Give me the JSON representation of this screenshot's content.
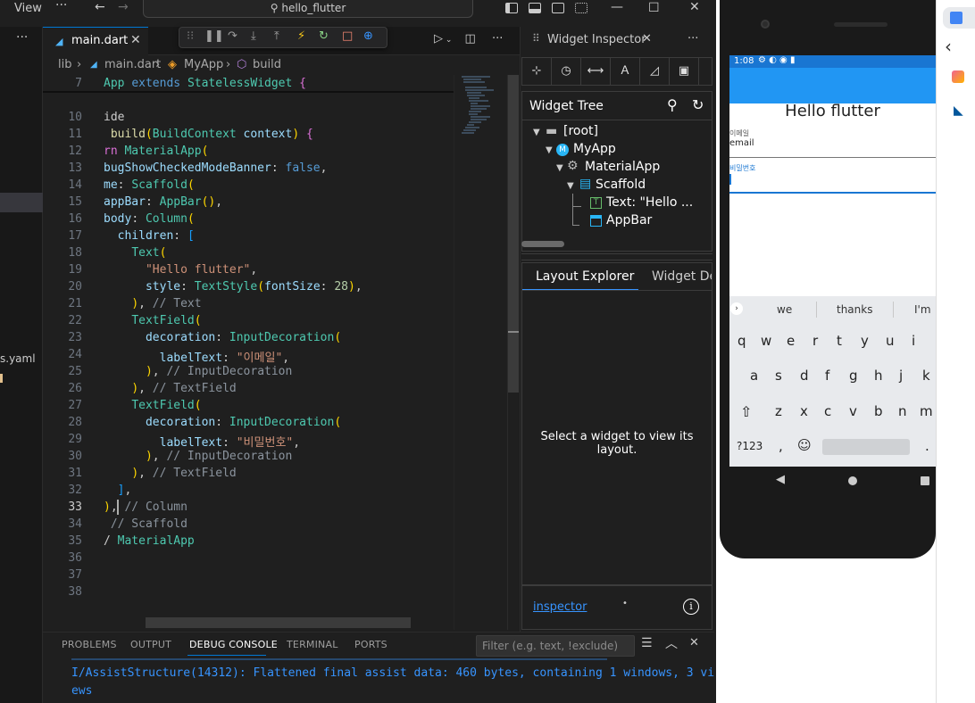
{
  "titlebar": {
    "menu_view": "View",
    "menu_more": "···",
    "search_label": "hello_flutter"
  },
  "sidebar": {
    "more": "···",
    "file_label": "s.yaml"
  },
  "editor": {
    "tab_label": "main.dart",
    "breadcrumb": [
      "lib",
      "main.dart",
      "MyApp",
      "build"
    ],
    "current_line": 33
  },
  "code_lines": [
    {
      "n": "7",
      "text": "App extends StatelessWidget {"
    },
    {
      "n": "10",
      "text": "ide"
    },
    {
      "n": "11",
      "text": " build(BuildContext context) {"
    },
    {
      "n": "12",
      "text": "rn MaterialApp("
    },
    {
      "n": "13",
      "text": "bugShowCheckedModeBanner: false,"
    },
    {
      "n": "14",
      "text": "me: Scaffold("
    },
    {
      "n": "15",
      "text": "appBar: AppBar(),"
    },
    {
      "n": "16",
      "text": "body: Column("
    },
    {
      "n": "17",
      "text": "  children: ["
    },
    {
      "n": "18",
      "text": "    Text("
    },
    {
      "n": "19",
      "text": "      \"Hello flutter\","
    },
    {
      "n": "20",
      "text": "      style: TextStyle(fontSize: 28),"
    },
    {
      "n": "21",
      "text": "    ), // Text"
    },
    {
      "n": "22",
      "text": "    TextField("
    },
    {
      "n": "23",
      "text": "      decoration: InputDecoration("
    },
    {
      "n": "24",
      "text": "        labelText: \"이메일\","
    },
    {
      "n": "25",
      "text": "      ), // InputDecoration"
    },
    {
      "n": "26",
      "text": "    ), // TextField"
    },
    {
      "n": "27",
      "text": "    TextField("
    },
    {
      "n": "28",
      "text": "      decoration: InputDecoration("
    },
    {
      "n": "29",
      "text": "        labelText: \"비밀번호\","
    },
    {
      "n": "30",
      "text": "      ), // InputDecoration"
    },
    {
      "n": "31",
      "text": "    ), // TextField"
    },
    {
      "n": "32",
      "text": "  ],"
    },
    {
      "n": "33",
      "text": "), // Column"
    },
    {
      "n": "34",
      "text": " // Scaffold"
    },
    {
      "n": "35",
      "text": "/ MaterialApp"
    },
    {
      "n": "36",
      "text": ""
    },
    {
      "n": "37",
      "text": ""
    },
    {
      "n": "38",
      "text": ""
    }
  ],
  "inspector": {
    "tab_label": "Widget Inspector",
    "widget_tree_title": "Widget Tree",
    "tree": {
      "root": "[root]",
      "myapp": "MyApp",
      "materialapp": "MaterialApp",
      "scaffold": "Scaffold",
      "text": "Text: \"Hello ...",
      "appbar": "AppBar"
    },
    "layout_tab": "Layout Explorer",
    "details_tab": "Widget Deta",
    "empty_message": "Select a widget to view its layout.",
    "footer_link": "inspector",
    "footer_dot": "•"
  },
  "panel": {
    "tabs": [
      "PROBLEMS",
      "OUTPUT",
      "DEBUG CONSOLE",
      "TERMINAL",
      "PORTS"
    ],
    "filter_placeholder": "Filter (e.g. text, !exclude)",
    "console_lines": [
      "I/AssistStructure(14312): Flattened final assist data: 460 bytes, containing 1 windows, 3 vi",
      "ews"
    ]
  },
  "emulator": {
    "time": "1:08",
    "title_text": "Hello flutter",
    "email_label": "이메일",
    "email_value": "email",
    "password_label": "비밀번호",
    "suggestions": [
      "we",
      "thanks",
      "I'm"
    ],
    "keys_row1": [
      "q",
      "w",
      "e",
      "r",
      "t",
      "y",
      "u",
      "i"
    ],
    "keys_row2": [
      "a",
      "s",
      "d",
      "f",
      "g",
      "h",
      "j",
      "k"
    ],
    "keys_row3": [
      "z",
      "x",
      "c",
      "v",
      "b",
      "n",
      "m"
    ],
    "key_symbols": "?123",
    "key_comma": ",",
    "key_period": "."
  },
  "colors": {
    "accent": "#0078d4",
    "app_bar": "#2196f3",
    "link": "#3794ff"
  }
}
